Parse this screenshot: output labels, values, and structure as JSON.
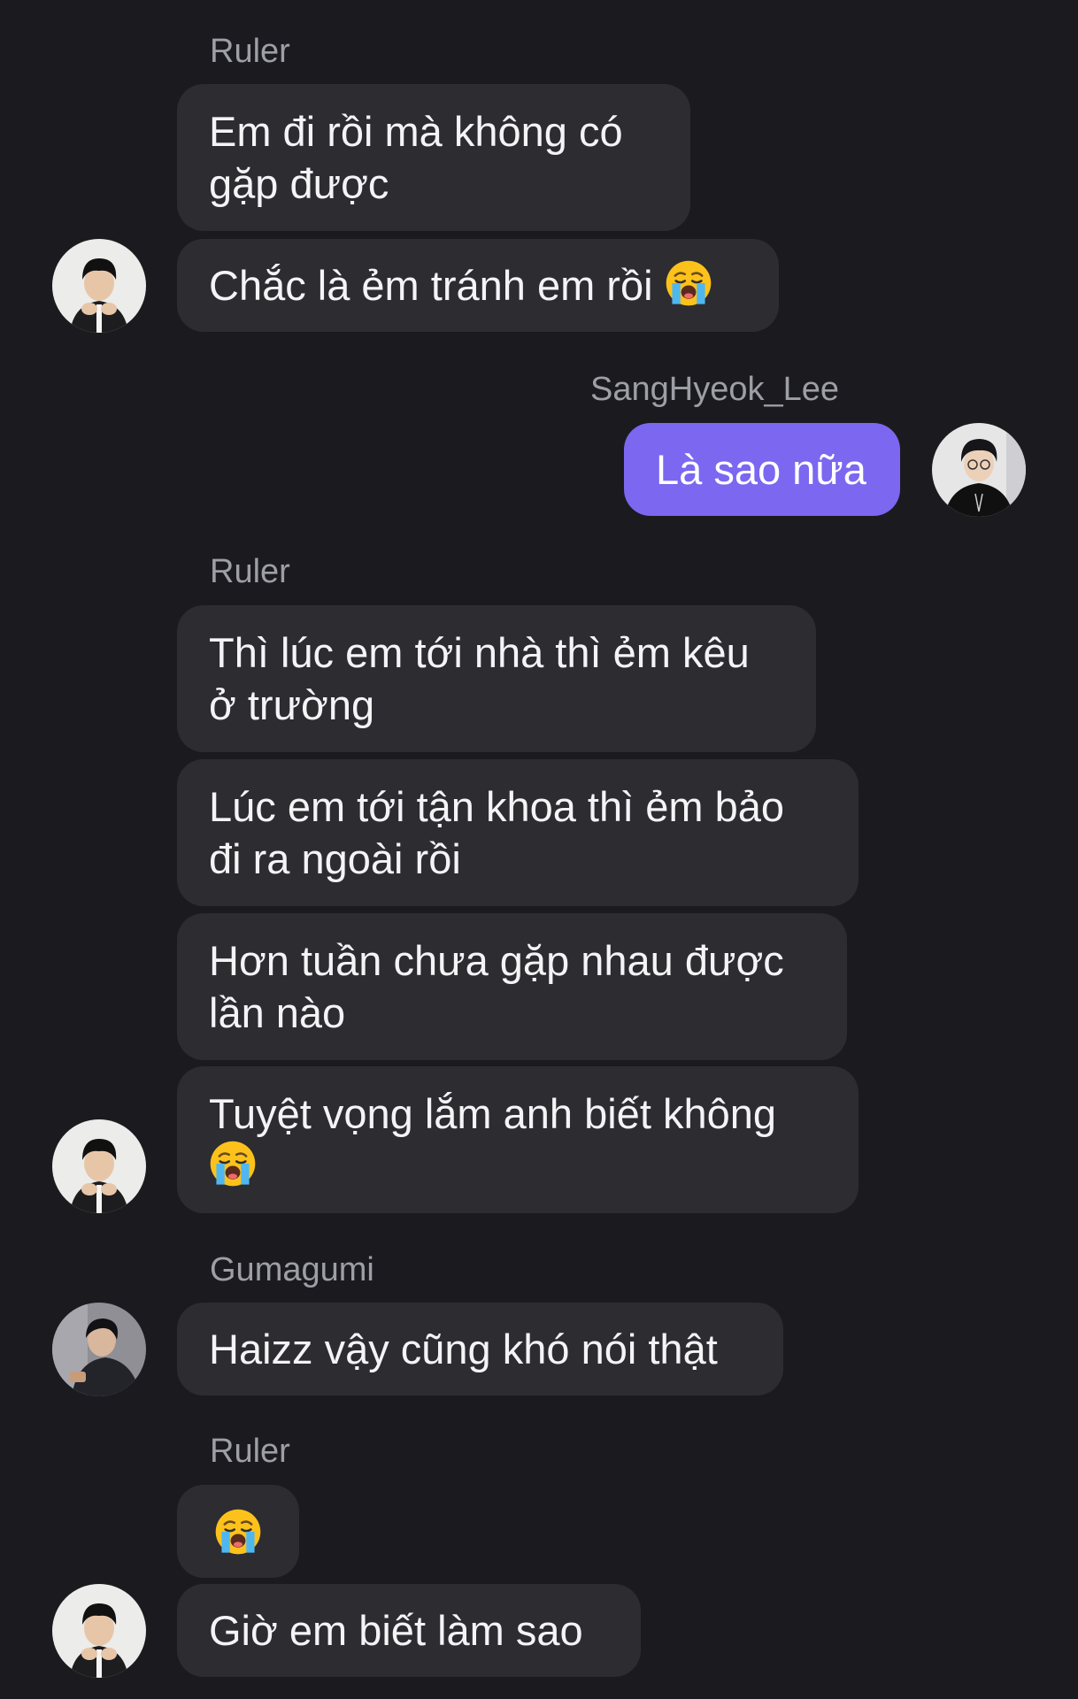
{
  "colors": {
    "background": "#1b1b1f",
    "bubble_other": "#2c2c31",
    "bubble_mine": "#7c67f0",
    "sender_name": "#9e9ea6"
  },
  "messages": {
    "g1": {
      "sender": "Ruler",
      "m1": "Em đi rồi mà không có\ngặp được",
      "m2": "Chắc là ẻm tránh em rồi"
    },
    "g2": {
      "sender": "SangHyeok_Lee",
      "m1": "Là sao nữa"
    },
    "g3": {
      "sender": "Ruler",
      "m1": "Thì lúc em tới nhà thì ẻm kêu\nở trường",
      "m2": "Lúc em tới tận khoa thì ẻm bảo\nđi ra ngoài rồi",
      "m3": "Hơn tuần chưa gặp nhau được\nlần nào",
      "m4": "Tuyệt vọng lắm anh biết không"
    },
    "g4": {
      "sender": "Gumagumi",
      "m1": "Haizz vậy cũng khó nói thật"
    },
    "g5": {
      "sender": "Ruler",
      "m2": "Giờ em biết làm sao"
    }
  },
  "icons": {
    "crying": "loudly-crying-face-icon",
    "avatar_ruler": "avatar-ruler",
    "avatar_sanghyeok": "avatar-sanghyeok-lee",
    "avatar_gumagumi": "avatar-gumagumi"
  }
}
